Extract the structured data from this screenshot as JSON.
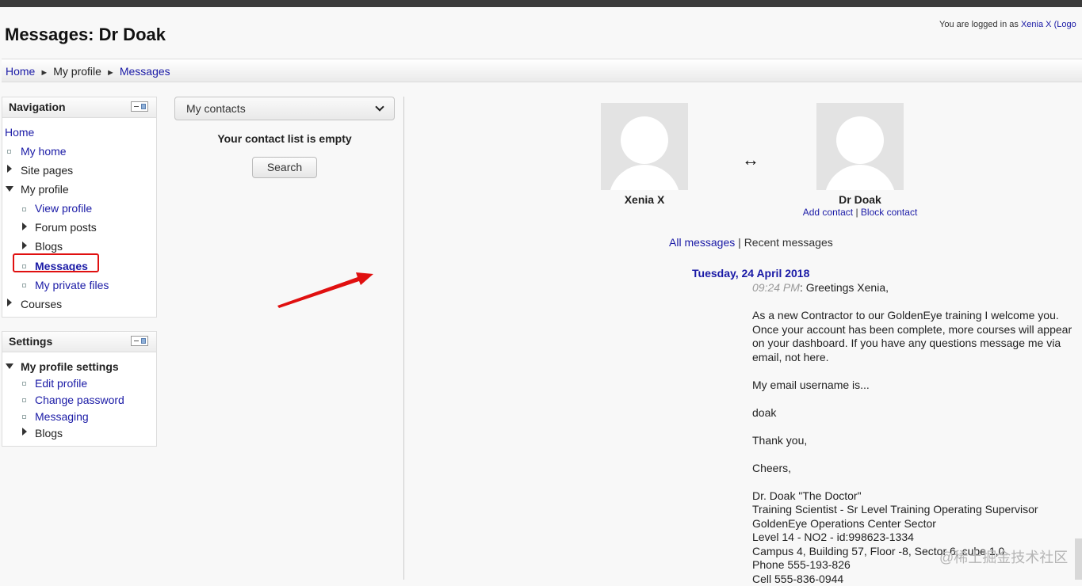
{
  "page": {
    "title": "Messages: Dr Doak",
    "login": {
      "prefix": "You are logged in as",
      "user": "Xenia X",
      "logout": "(Logo"
    }
  },
  "breadcrumb": {
    "home": "Home",
    "profile": "My profile",
    "messages": "Messages",
    "separator": "►"
  },
  "navigation": {
    "title": "Navigation",
    "items": [
      {
        "label": "Home"
      },
      {
        "label": "My home"
      },
      {
        "label": "Site pages"
      },
      {
        "label": "My profile"
      },
      {
        "label": "View profile"
      },
      {
        "label": "Forum posts"
      },
      {
        "label": "Blogs"
      },
      {
        "label": "Messages"
      },
      {
        "label": "My private files"
      },
      {
        "label": "Courses"
      }
    ]
  },
  "settings": {
    "title": "Settings",
    "items": [
      {
        "label": "My profile settings"
      },
      {
        "label": "Edit profile"
      },
      {
        "label": "Change password"
      },
      {
        "label": "Messaging"
      },
      {
        "label": "Blogs"
      }
    ]
  },
  "contacts": {
    "select_value": "My contacts",
    "empty_text": "Your contact list is empty",
    "search_label": "Search"
  },
  "conversation": {
    "user_left": "Xenia X",
    "user_right": "Dr Doak",
    "swap_symbol": "↔",
    "add_contact": "Add contact",
    "separator": "|",
    "block_contact": "Block contact",
    "all_messages": "All messages",
    "recent_messages": "Recent messages",
    "date": "Tuesday, 24 April 2018",
    "time": "09:24 PM",
    "greeting": ": Greetings Xenia,",
    "paragraphs": [
      "As a new Contractor to our GoldenEye training I welcome you. Once your account has been complete, more courses will appear on your dashboard. If you have any questions message me via email, not here.",
      "My email username is...",
      "doak",
      "Thank you,",
      "Cheers,"
    ],
    "signature": [
      "Dr. Doak \"The Doctor\"",
      "Training Scientist - Sr Level Training Operating Supervisor",
      "GoldenEye Operations Center Sector",
      "Level 14 - NO2 - id:998623-1334",
      "Campus 4, Building 57, Floor -8, Sector 6, cube 1,0",
      "Phone 555-193-826",
      "Cell 555-836-0944"
    ]
  },
  "watermark": "@稀土掘金技术社区",
  "colors": {
    "link": "#1a1aa6",
    "highlight": "#e01010",
    "arrow": "#e01010"
  }
}
